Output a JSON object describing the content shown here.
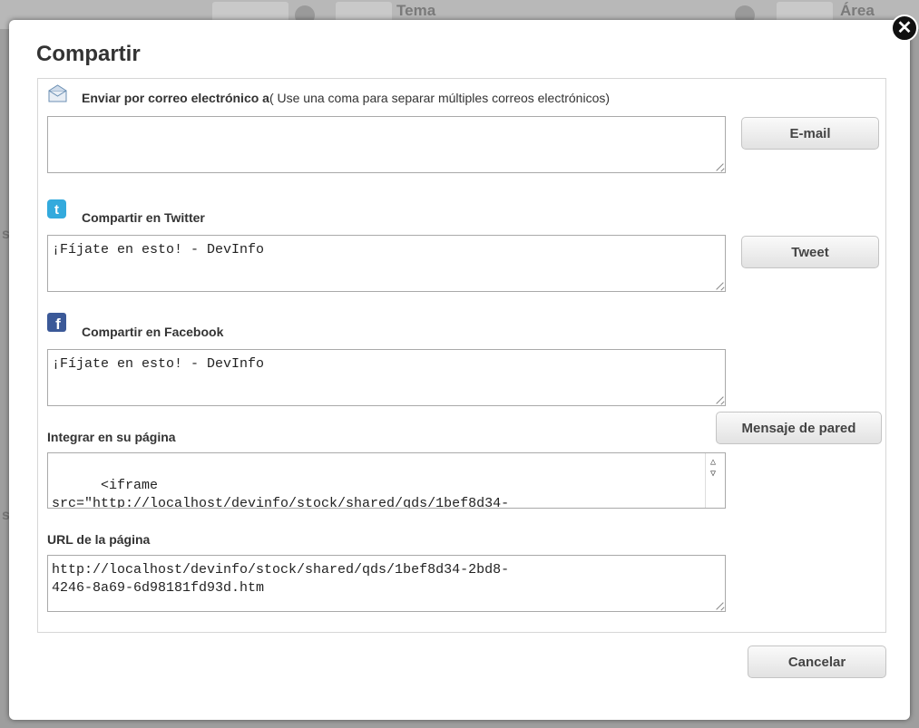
{
  "background": {
    "tab_tema": "Tema",
    "tab_area": "Área"
  },
  "dialog": {
    "title": "Compartir",
    "close_icon": "close-icon",
    "email": {
      "label": "Enviar por correo electrónico a",
      "hint": "( Use una coma para separar múltiples correos electrónicos)",
      "value": "",
      "button": "E-mail"
    },
    "twitter": {
      "label": "Compartir en Twitter",
      "value": "¡Fíjate en esto! - DevInfo",
      "button": "Tweet"
    },
    "facebook": {
      "label": "Compartir en Facebook",
      "value": "¡Fíjate en esto! - DevInfo",
      "button": "Mensaje de pared"
    },
    "embed": {
      "label": "Integrar en su página",
      "value": "<iframe\nsrc=\"http://localhost/devinfo/stock/shared/qds/1bef8d34-"
    },
    "url": {
      "label": "URL de la página",
      "value": "http://localhost/devinfo/stock/shared/qds/1bef8d34-2bd8-\n4246-8a69-6d98181fd93d.htm"
    },
    "cancel_button": "Cancelar"
  },
  "colors": {
    "twitter_blue": "#33aadd",
    "facebook_blue": "#3b5998",
    "overlay_gray": "#9e9e9e"
  }
}
